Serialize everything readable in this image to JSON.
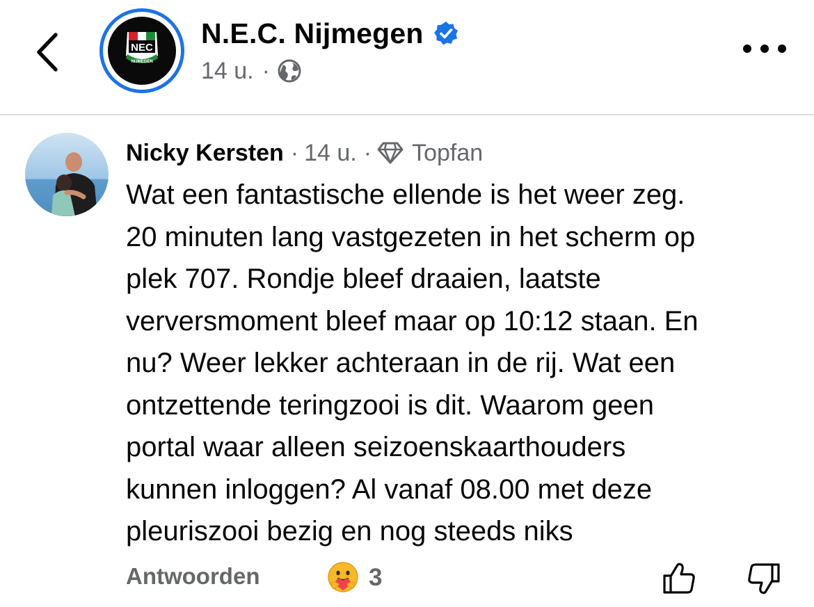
{
  "header": {
    "back_icon": "chevron-left-icon",
    "page_avatar": {
      "logo_text": "NEC",
      "logo_subtext": "NIJMEGEN"
    },
    "page_name": "N.E.C. Nijmegen",
    "verified_icon": "verified-badge-icon",
    "time": "14 u.",
    "dot": "·",
    "audience_icon": "globe-icon",
    "more_icon": "more-options-icon"
  },
  "comment": {
    "author": "Nicky Kersten",
    "dot": "·",
    "time": "14 u.",
    "badge_icon": "diamond-icon",
    "badge": "Topfan",
    "text": "Wat een fantastische ellende is het weer zeg.\n20 minuten lang vastgezeten in het scherm op\nplek 707. Rondje bleef draaien, laatste\nverversmoment bleef maar op 10:12 staan. En\nnu? Weer lekker achteraan in de rij. Wat een\nontzettende teringzooi is dit. Waarom geen\nportal waar alleen seizoenskaarthouders\nkunnen inloggen? Al vanaf 08.00 met deze\npleuriszooi bezig en nog steeds niks"
  },
  "actions": {
    "reply": "Antwoorden",
    "reaction_icon": "care-reaction-icon",
    "reaction_count": "3",
    "like_icon": "thumbs-up-icon",
    "dislike_icon": "thumbs-down-icon"
  },
  "colors": {
    "accent": "#1b74e4",
    "text": "#050505",
    "muted": "#65676b",
    "divider": "#dcdde1",
    "logo_green": "#1d8a3a",
    "logo_red": "#d6202a",
    "reaction_yellow": "#f7b928"
  }
}
